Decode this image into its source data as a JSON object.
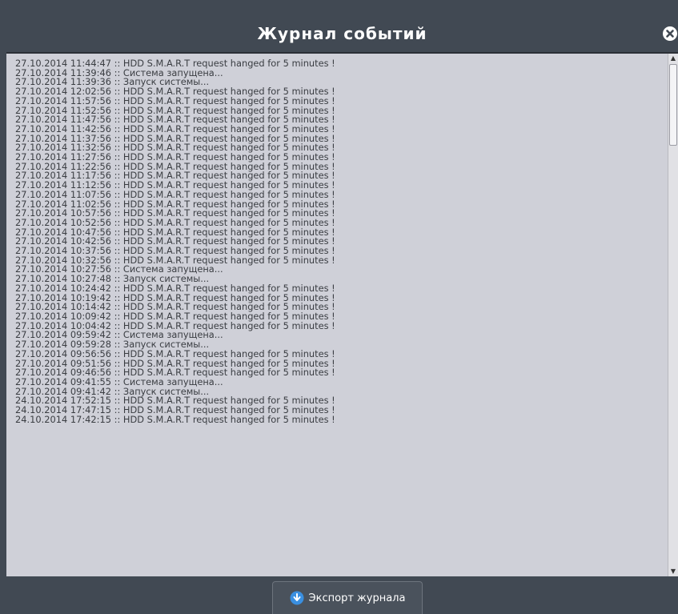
{
  "window": {
    "title": "Журнал событий",
    "close_icon": "close-icon"
  },
  "log": {
    "lines": [
      "27.10.2014 11:44:47 :: HDD S.M.A.R.T request hanged for 5 minutes !",
      "27.10.2014 11:39:46 :: Система запущена...",
      "27.10.2014 11:39:36 :: Запуск системы...",
      "27.10.2014 12:02:56 :: HDD S.M.A.R.T request hanged for 5 minutes !",
      "27.10.2014 11:57:56 :: HDD S.M.A.R.T request hanged for 5 minutes !",
      "27.10.2014 11:52:56 :: HDD S.M.A.R.T request hanged for 5 minutes !",
      "27.10.2014 11:47:56 :: HDD S.M.A.R.T request hanged for 5 minutes !",
      "27.10.2014 11:42:56 :: HDD S.M.A.R.T request hanged for 5 minutes !",
      "27.10.2014 11:37:56 :: HDD S.M.A.R.T request hanged for 5 minutes !",
      "27.10.2014 11:32:56 :: HDD S.M.A.R.T request hanged for 5 minutes !",
      "27.10.2014 11:27:56 :: HDD S.M.A.R.T request hanged for 5 minutes !",
      "27.10.2014 11:22:56 :: HDD S.M.A.R.T request hanged for 5 minutes !",
      "27.10.2014 11:17:56 :: HDD S.M.A.R.T request hanged for 5 minutes !",
      "27.10.2014 11:12:56 :: HDD S.M.A.R.T request hanged for 5 minutes !",
      "27.10.2014 11:07:56 :: HDD S.M.A.R.T request hanged for 5 minutes !",
      "27.10.2014 11:02:56 :: HDD S.M.A.R.T request hanged for 5 minutes !",
      "27.10.2014 10:57:56 :: HDD S.M.A.R.T request hanged for 5 minutes !",
      "27.10.2014 10:52:56 :: HDD S.M.A.R.T request hanged for 5 minutes !",
      "27.10.2014 10:47:56 :: HDD S.M.A.R.T request hanged for 5 minutes !",
      "27.10.2014 10:42:56 :: HDD S.M.A.R.T request hanged for 5 minutes !",
      "27.10.2014 10:37:56 :: HDD S.M.A.R.T request hanged for 5 minutes !",
      "27.10.2014 10:32:56 :: HDD S.M.A.R.T request hanged for 5 minutes !",
      "27.10.2014 10:27:56 :: Система запущена...",
      "27.10.2014 10:27:48 :: Запуск системы...",
      "27.10.2014 10:24:42 :: HDD S.M.A.R.T request hanged for 5 minutes !",
      "27.10.2014 10:19:42 :: HDD S.M.A.R.T request hanged for 5 minutes !",
      "27.10.2014 10:14:42 :: HDD S.M.A.R.T request hanged for 5 minutes !",
      "27.10.2014 10:09:42 :: HDD S.M.A.R.T request hanged for 5 minutes !",
      "27.10.2014 10:04:42 :: HDD S.M.A.R.T request hanged for 5 minutes !",
      "27.10.2014 09:59:42 :: Система запущена...",
      "27.10.2014 09:59:28 :: Запуск системы...",
      "27.10.2014 09:56:56 :: HDD S.M.A.R.T request hanged for 5 minutes !",
      "27.10.2014 09:51:56 :: HDD S.M.A.R.T request hanged for 5 minutes !",
      "27.10.2014 09:46:56 :: HDD S.M.A.R.T request hanged for 5 minutes !",
      "27.10.2014 09:41:55 :: Система запущена...",
      "27.10.2014 09:41:42 :: Запуск системы...",
      "24.10.2014 17:52:15 :: HDD S.M.A.R.T request hanged for 5 minutes !",
      "24.10.2014 17:47:15 :: HDD S.M.A.R.T request hanged for 5 minutes !",
      "24.10.2014 17:42:15 :: HDD S.M.A.R.T request hanged for 5 minutes !"
    ]
  },
  "footer": {
    "export_label": "Экспорт журнала",
    "export_icon": "download-icon"
  },
  "colors": {
    "window_bg": "#414953",
    "log_bg": "#cfd0d8",
    "text": "#3a3d42",
    "export_icon_blue": "#3a8fe0"
  }
}
